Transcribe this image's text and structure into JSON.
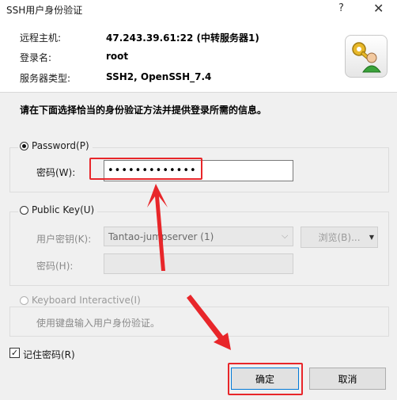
{
  "window": {
    "title": "SSH用户身份验证",
    "help_glyph": "?",
    "close_glyph": "✕"
  },
  "info": {
    "host_label": "远程主机:",
    "host_value": "47.243.39.61:22 (中转服务器1)",
    "login_label": "登录名:",
    "login_value": "root",
    "server_type_label": "服务器类型:",
    "server_type_value": "SSH2, OpenSSH_7.4"
  },
  "instruction": "请在下面选择恰当的身份验证方法并提供登录所需的信息。",
  "password_group": {
    "radio_label": "Password(P)",
    "selected": true,
    "field_label": "密码(W):",
    "field_value": "•••••••••••••"
  },
  "public_key_group": {
    "radio_label": "Public Key(U)",
    "user_key_label": "用户密钥(K):",
    "user_key_value": "Tantao-jumpserver (1)",
    "browse_label": "浏览(B)...",
    "passphrase_label": "密码(H):"
  },
  "keyboard_group": {
    "radio_label": "Keyboard Interactive(I)",
    "description": "使用键盘输入用户身份验证。"
  },
  "remember": {
    "label": "记住密码(R)",
    "checked": true
  },
  "buttons": {
    "ok": "确定",
    "cancel": "取消"
  },
  "colors": {
    "annotation": "#e8262a",
    "background": "#f0f0f0"
  }
}
